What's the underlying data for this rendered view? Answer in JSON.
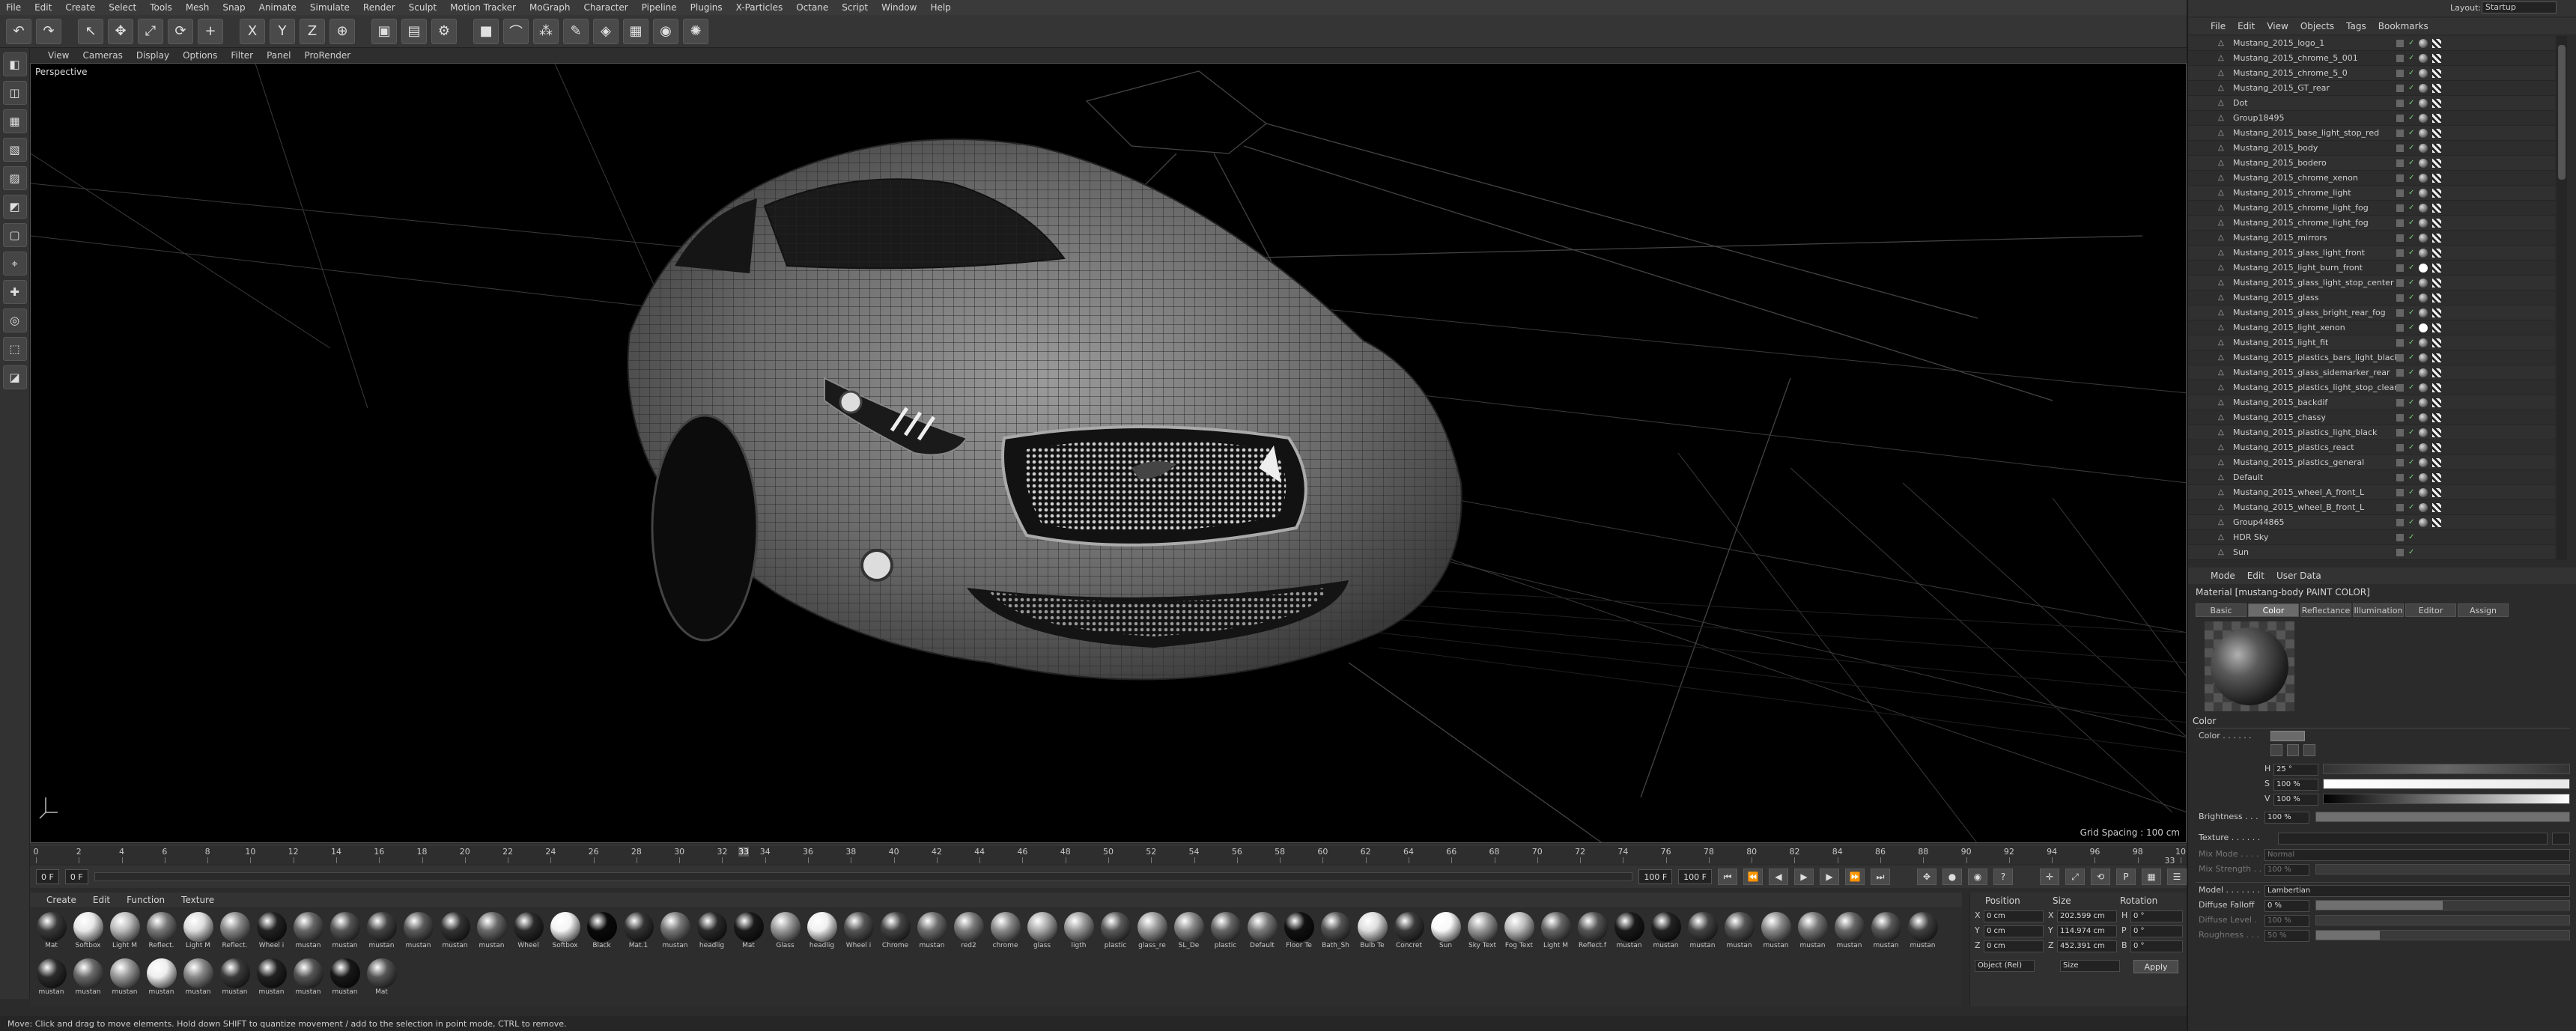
{
  "menu": [
    "File",
    "Edit",
    "Create",
    "Select",
    "Tools",
    "Mesh",
    "Snap",
    "Animate",
    "Simulate",
    "Render",
    "Sculpt",
    "Motion Tracker",
    "MoGraph",
    "Character",
    "Pipeline",
    "Plugins",
    "X-Particles",
    "Octane",
    "Script",
    "Window",
    "Help"
  ],
  "toolbar_icons": [
    "undo-icon",
    "redo-icon",
    "live-select-icon",
    "move-icon",
    "scale-icon",
    "rotate-icon",
    "add-icon",
    "x-axis-icon",
    "y-axis-icon",
    "z-axis-icon",
    "world-coord-icon",
    "render-view-icon",
    "render-picture-queue-icon",
    "render-settings-icon",
    "cube-icon",
    "bend-icon",
    "array-icon",
    "pen-icon",
    "subdivision-icon",
    "floor-icon",
    "camera-icon",
    "light-icon"
  ],
  "toolbar_glyphs": [
    "↶",
    "↷",
    "↖",
    "✥",
    "⤢",
    "⟳",
    "+",
    "X",
    "Y",
    "Z",
    "⊕",
    "▣",
    "▤",
    "⚙",
    "■",
    "⌒",
    "⁂",
    "✎",
    "◈",
    "▦",
    "◉",
    "✺"
  ],
  "left_tools": [
    "◧",
    "◫",
    "▦",
    "▧",
    "▨",
    "◩",
    "▢",
    "⌖",
    "✚",
    "◎",
    "⬚",
    "◪"
  ],
  "viewport": {
    "menu": [
      "View",
      "Cameras",
      "Display",
      "Options",
      "Filter",
      "Panel",
      "ProRender"
    ],
    "label": "Perspective",
    "grid_spacing": "Grid Spacing : 100 cm"
  },
  "timeline": {
    "ticks": [
      "0",
      "2",
      "4",
      "6",
      "8",
      "10",
      "12",
      "14",
      "16",
      "18",
      "20",
      "22",
      "24",
      "26",
      "28",
      "30",
      "32",
      "34",
      "36",
      "38",
      "40",
      "42",
      "44",
      "46",
      "48",
      "50",
      "52",
      "54",
      "56",
      "58",
      "60",
      "62",
      "64",
      "66",
      "68",
      "70",
      "72",
      "74",
      "76",
      "78",
      "80",
      "82",
      "84",
      "86",
      "88",
      "90",
      "92",
      "94",
      "96",
      "98",
      "10"
    ],
    "current_frame_marker": "33",
    "frame_end_label": "33 F"
  },
  "playback": {
    "start_field": "0 F",
    "start_field2": "0 F",
    "end_field": "100 F",
    "end_field2": "100 F"
  },
  "materials": {
    "menu": [
      "Create",
      "Edit",
      "Function",
      "Texture"
    ],
    "items": [
      {
        "name": "Mat",
        "color": "#3a3a3a"
      },
      {
        "name": "Softbox",
        "color": "#e8e8e8"
      },
      {
        "name": "Light M",
        "color": "#bbbbbb"
      },
      {
        "name": "Reflect.",
        "color": "#777777"
      },
      {
        "name": "Light M",
        "color": "#dddddd"
      },
      {
        "name": "Reflect.",
        "color": "#888888"
      },
      {
        "name": "Wheel i",
        "color": "#222222"
      },
      {
        "name": "mustan",
        "color": "#666666"
      },
      {
        "name": "mustan",
        "color": "#555555"
      },
      {
        "name": "mustan",
        "color": "#444444"
      },
      {
        "name": "mustan",
        "color": "#5a5a5a"
      },
      {
        "name": "mustan",
        "color": "#333333"
      },
      {
        "name": "mustan",
        "color": "#6a6a6a"
      },
      {
        "name": "Wheel",
        "color": "#2a2a2a"
      },
      {
        "name": "Softbox",
        "color": "#f4f4f4"
      },
      {
        "name": "Black",
        "color": "#0a0a0a"
      },
      {
        "name": "Mat.1",
        "color": "#333333"
      },
      {
        "name": "mustan",
        "color": "#777777"
      },
      {
        "name": "headlig",
        "color": "#2a2a2a"
      },
      {
        "name": "Mat",
        "color": "#1a1a1a"
      },
      {
        "name": "Glass",
        "color": "#9a9a9a"
      },
      {
        "name": "headlig",
        "color": "#f0f0f0"
      },
      {
        "name": "Wheel i",
        "color": "#555555"
      },
      {
        "name": "Chrome",
        "color": "#444444"
      },
      {
        "name": "mustan",
        "color": "#6e6e6e"
      },
      {
        "name": "red2",
        "color": "#7a7a7a"
      },
      {
        "name": "chrome",
        "color": "#8a8a8a"
      },
      {
        "name": "glass",
        "color": "#aaaaaa"
      },
      {
        "name": "ligth",
        "color": "#999999"
      },
      {
        "name": "plastic",
        "color": "#5a5a5a"
      },
      {
        "name": "glass_re",
        "color": "#9a9a9a"
      },
      {
        "name": "SL_De",
        "color": "#888888"
      },
      {
        "name": "plastic",
        "color": "#666666"
      },
      {
        "name": "Default",
        "color": "#7a7a7a"
      },
      {
        "name": "Floor Te",
        "color": "#111111"
      },
      {
        "name": "Bath_Sh",
        "color": "#555555"
      },
      {
        "name": "Bulb Te",
        "color": "#dddddd"
      },
      {
        "name": "Concret",
        "color": "#3a3a3a"
      },
      {
        "name": "Sun",
        "color": "#f8f8f8"
      },
      {
        "name": "Sky Text",
        "color": "#999999"
      },
      {
        "name": "Fog Text",
        "color": "#bbbbbb"
      },
      {
        "name": "Light M",
        "color": "#666666"
      },
      {
        "name": "Reflect.f",
        "color": "#555555"
      },
      {
        "name": "mustan",
        "color": "#1a1a1a"
      },
      {
        "name": "mustan",
        "color": "#222222"
      },
      {
        "name": "mustan",
        "color": "#444444"
      },
      {
        "name": "mustan",
        "color": "#555555"
      },
      {
        "name": "mustan",
        "color": "#8a8a8a"
      },
      {
        "name": "mustan",
        "color": "#777777"
      },
      {
        "name": "mustan",
        "color": "#666666"
      },
      {
        "name": "mustan",
        "color": "#585858"
      },
      {
        "name": "mustan",
        "color": "#404040"
      },
      {
        "name": "mustan",
        "color": "#2c2c2c"
      },
      {
        "name": "mustan",
        "color": "#6a6a6a"
      },
      {
        "name": "mustan",
        "color": "#999999"
      },
      {
        "name": "mustan",
        "color": "#eeeeee"
      },
      {
        "name": "mustan",
        "color": "#888888"
      },
      {
        "name": "mustan",
        "color": "#3a3a3a"
      },
      {
        "name": "mustan",
        "color": "#222222"
      },
      {
        "name": "mustan",
        "color": "#555555"
      },
      {
        "name": "mustan",
        "color": "#181818"
      },
      {
        "name": "Mat",
        "color": "#555555"
      }
    ]
  },
  "coordinates": {
    "headers": [
      "Position",
      "Size",
      "Rotation"
    ],
    "rows": [
      {
        "axis": "X",
        "pos": "0 cm",
        "size": "202.599 cm",
        "rlab": "H",
        "rot": "0 °"
      },
      {
        "axis": "Y",
        "pos": "0 cm",
        "size": "114.974 cm",
        "rlab": "P",
        "rot": "0 °"
      },
      {
        "axis": "Z",
        "pos": "0 cm",
        "size": "452.391 cm",
        "rlab": "B",
        "rot": "0 °"
      }
    ],
    "mode_dropdown": "Object (Rel)",
    "size_dropdown": "Size",
    "apply": "Apply"
  },
  "status": "Move: Click and drag to move elements. Hold down SHIFT to quantize movement / add to the selection in point mode, CTRL to remove.",
  "right": {
    "layout_label": "Layout:",
    "layout_value": "Startup",
    "obj_menu": [
      "File",
      "Edit",
      "View",
      "Objects",
      "Tags",
      "Bookmarks"
    ],
    "objects": [
      {
        "name": "Mustang_2015_logo_1",
        "tag": "ball"
      },
      {
        "name": "Mustang_2015_chrome_5_001",
        "tag": "ball"
      },
      {
        "name": "Mustang_2015_chrome_5_0",
        "tag": "ball"
      },
      {
        "name": "Mustang_2015_GT_rear",
        "tag": "ball"
      },
      {
        "name": "Dot",
        "tag": "ball"
      },
      {
        "name": "Group18495",
        "tag": "ball"
      },
      {
        "name": "Mustang_2015_base_light_stop_red",
        "tag": "ball"
      },
      {
        "name": "Mustang_2015_body",
        "tag": "ball"
      },
      {
        "name": "Mustang_2015_bodero",
        "tag": "ball"
      },
      {
        "name": "Mustang_2015_chrome_xenon",
        "tag": "ball"
      },
      {
        "name": "Mustang_2015_chrome_light",
        "tag": "ball"
      },
      {
        "name": "Mustang_2015_chrome_light_fog",
        "tag": "ball"
      },
      {
        "name": "Mustang_2015_chrome_light_fog",
        "tag": "ball"
      },
      {
        "name": "Mustang_2015_mirrors",
        "tag": "ball"
      },
      {
        "name": "Mustang_2015_glass_light_front",
        "tag": "ball"
      },
      {
        "name": "Mustang_2015_light_burn_front",
        "tag": "white"
      },
      {
        "name": "Mustang_2015_glass_light_stop_center",
        "tag": "ball"
      },
      {
        "name": "Mustang_2015_glass",
        "tag": "ball"
      },
      {
        "name": "Mustang_2015_glass_bright_rear_fog",
        "tag": "ball"
      },
      {
        "name": "Mustang_2015_light_xenon",
        "tag": "white"
      },
      {
        "name": "Mustang_2015_light_fit",
        "tag": "ball"
      },
      {
        "name": "Mustang_2015_plastics_bars_light_black",
        "tag": "ball"
      },
      {
        "name": "Mustang_2015_glass_sidemarker_rear",
        "tag": "ball"
      },
      {
        "name": "Mustang_2015_plastics_light_stop_clear",
        "tag": "ball"
      },
      {
        "name": "Mustang_2015_backdif",
        "tag": "ball"
      },
      {
        "name": "Mustang_2015_chassy",
        "tag": "ball"
      },
      {
        "name": "Mustang_2015_plastics_light_black",
        "tag": "ball"
      },
      {
        "name": "Mustang_2015_plastics_react",
        "tag": "ball"
      },
      {
        "name": "Mustang_2015_plastics_general",
        "tag": "ball"
      },
      {
        "name": "Default",
        "tag": "ball"
      },
      {
        "name": "Mustang_2015_wheel_A_front_L",
        "tag": "ball"
      },
      {
        "name": "Mustang_2015_wheel_B_front_L",
        "tag": "ball"
      },
      {
        "name": "Group44865",
        "tag": "ball"
      },
      {
        "name": "HDR Sky",
        "tag": "none"
      },
      {
        "name": "Sun",
        "tag": "none"
      }
    ],
    "attr_menu": [
      "Mode",
      "Edit",
      "User Data"
    ],
    "material_title": "Material [mustang-body PAINT COLOR]",
    "tabs": [
      "Basic",
      "Color",
      "Reflectance",
      "Illumination",
      "Editor",
      "Assign"
    ],
    "active_tab": "Color",
    "color_section": "Color",
    "color_label": "Color . . . . . .",
    "h_label": "H",
    "h_value": "25 °",
    "s_label": "S",
    "s_value": "100 %",
    "v_label": "V",
    "v_value": "100 %",
    "brightness_label": "Brightness . . .",
    "brightness_value": "100 %",
    "texture_label": "Texture . . . . . .",
    "mix_mode_label": "Mix Mode . . . .",
    "mix_mode_value": "Normal",
    "mix_strength_label": "Mix Strength . .",
    "mix_strength_value": "100 %",
    "model_label": "Model . . . . . . .",
    "model_value": "Lambertian",
    "diffuse_falloff_label": "Diffuse Falloff",
    "diffuse_falloff_value": "0 %",
    "diffuse_level_label": "Diffuse Level .",
    "diffuse_level_value": "100 %",
    "roughness_label": "Roughness . . .",
    "roughness_value": "50 %",
    "diffuse_falloff_fraction": 0.5,
    "roughness_fraction": 0.25
  }
}
